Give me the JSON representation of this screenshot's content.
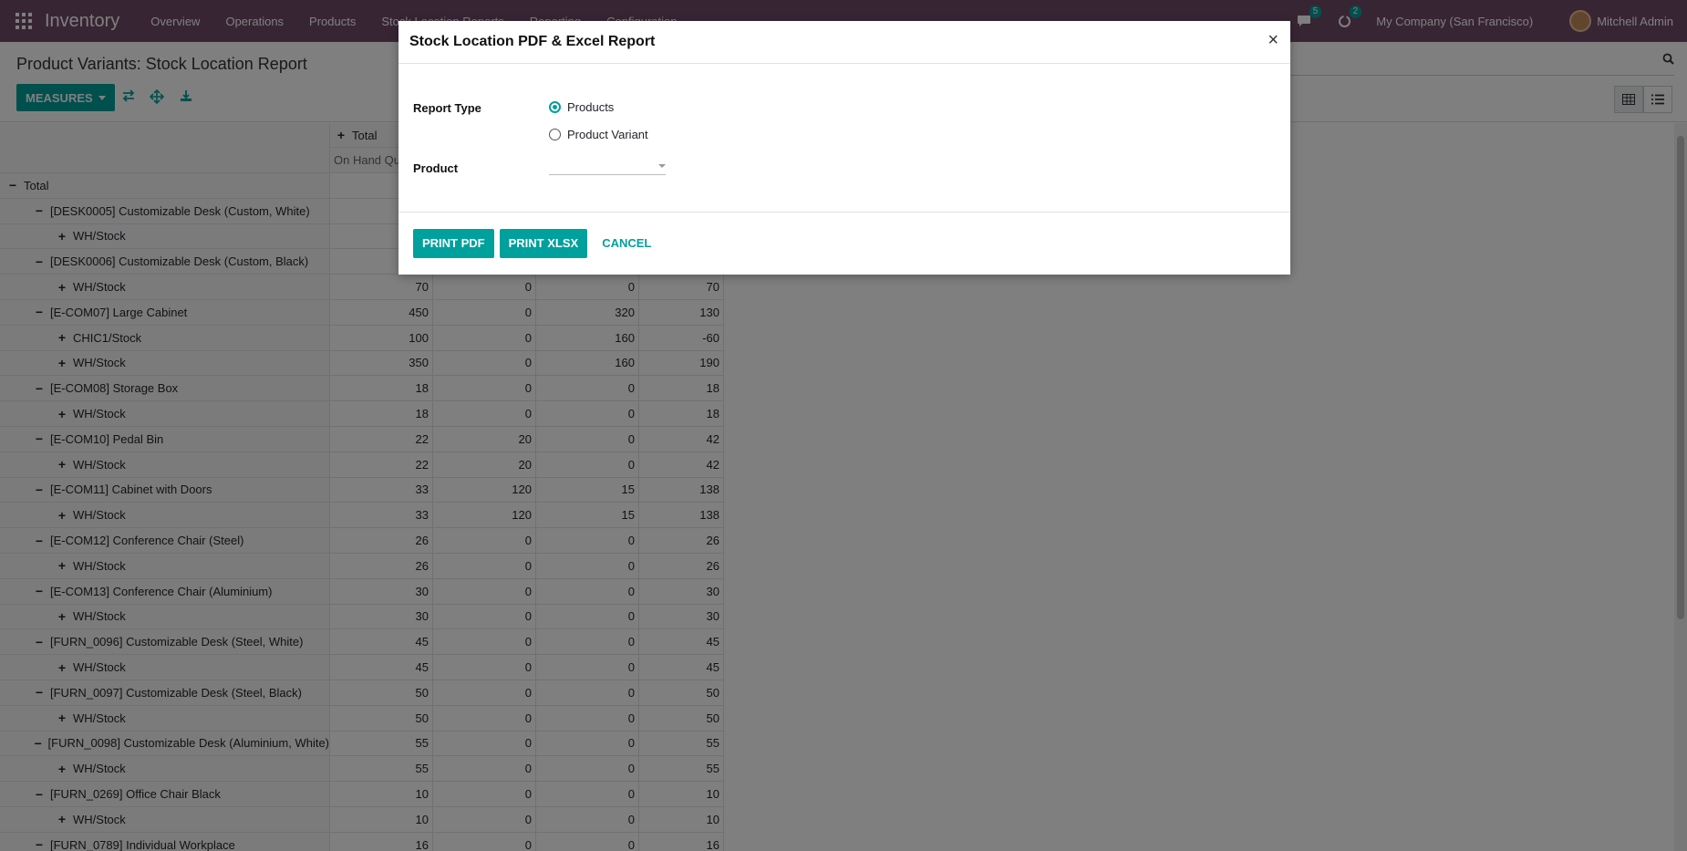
{
  "navbar": {
    "app_name": "Inventory",
    "menu": [
      "Overview",
      "Operations",
      "Products",
      "Stock Location Reports",
      "Reporting",
      "Configuration"
    ],
    "messages_count": "5",
    "activities_count": "2",
    "company": "My Company (San Francisco)",
    "user": "Mitchell Admin"
  },
  "control_panel": {
    "title": "Product Variants: Stock Location Report",
    "measures_label": "MEASURES"
  },
  "pivot": {
    "col_header": "Total",
    "col_subheader": "On Hand Qu",
    "total_label": "Total",
    "rows": [
      {
        "level": 1,
        "sign": "−",
        "label": "[DESK0005] Customizable Desk (Custom, White)",
        "values": [
          "",
          "",
          "",
          ""
        ]
      },
      {
        "level": 2,
        "sign": "+",
        "label": "WH/Stock",
        "values": [
          "",
          "",
          "",
          ""
        ]
      },
      {
        "level": 1,
        "sign": "−",
        "label": "[DESK0006] Customizable Desk (Custom, Black)",
        "values": [
          "",
          "",
          "",
          ""
        ]
      },
      {
        "level": 2,
        "sign": "+",
        "label": "WH/Stock",
        "values": [
          "70",
          "0",
          "0",
          "70"
        ]
      },
      {
        "level": 1,
        "sign": "−",
        "label": "[E-COM07] Large Cabinet",
        "values": [
          "450",
          "0",
          "320",
          "130"
        ]
      },
      {
        "level": 2,
        "sign": "+",
        "label": "CHIC1/Stock",
        "values": [
          "100",
          "0",
          "160",
          "-60"
        ]
      },
      {
        "level": 2,
        "sign": "+",
        "label": "WH/Stock",
        "values": [
          "350",
          "0",
          "160",
          "190"
        ]
      },
      {
        "level": 1,
        "sign": "−",
        "label": "[E-COM08] Storage Box",
        "values": [
          "18",
          "0",
          "0",
          "18"
        ]
      },
      {
        "level": 2,
        "sign": "+",
        "label": "WH/Stock",
        "values": [
          "18",
          "0",
          "0",
          "18"
        ]
      },
      {
        "level": 1,
        "sign": "−",
        "label": "[E-COM10] Pedal Bin",
        "values": [
          "22",
          "20",
          "0",
          "42"
        ]
      },
      {
        "level": 2,
        "sign": "+",
        "label": "WH/Stock",
        "values": [
          "22",
          "20",
          "0",
          "42"
        ]
      },
      {
        "level": 1,
        "sign": "−",
        "label": "[E-COM11] Cabinet with Doors",
        "values": [
          "33",
          "120",
          "15",
          "138"
        ]
      },
      {
        "level": 2,
        "sign": "+",
        "label": "WH/Stock",
        "values": [
          "33",
          "120",
          "15",
          "138"
        ]
      },
      {
        "level": 1,
        "sign": "−",
        "label": "[E-COM12] Conference Chair (Steel)",
        "values": [
          "26",
          "0",
          "0",
          "26"
        ]
      },
      {
        "level": 2,
        "sign": "+",
        "label": "WH/Stock",
        "values": [
          "26",
          "0",
          "0",
          "26"
        ]
      },
      {
        "level": 1,
        "sign": "−",
        "label": "[E-COM13] Conference Chair (Aluminium)",
        "values": [
          "30",
          "0",
          "0",
          "30"
        ]
      },
      {
        "level": 2,
        "sign": "+",
        "label": "WH/Stock",
        "values": [
          "30",
          "0",
          "0",
          "30"
        ]
      },
      {
        "level": 1,
        "sign": "−",
        "label": "[FURN_0096] Customizable Desk (Steel, White)",
        "values": [
          "45",
          "0",
          "0",
          "45"
        ]
      },
      {
        "level": 2,
        "sign": "+",
        "label": "WH/Stock",
        "values": [
          "45",
          "0",
          "0",
          "45"
        ]
      },
      {
        "level": 1,
        "sign": "−",
        "label": "[FURN_0097] Customizable Desk (Steel, Black)",
        "values": [
          "50",
          "0",
          "0",
          "50"
        ]
      },
      {
        "level": 2,
        "sign": "+",
        "label": "WH/Stock",
        "values": [
          "50",
          "0",
          "0",
          "50"
        ]
      },
      {
        "level": 1,
        "sign": "−",
        "label": "[FURN_0098] Customizable Desk (Aluminium, White)",
        "values": [
          "55",
          "0",
          "0",
          "55"
        ]
      },
      {
        "level": 2,
        "sign": "+",
        "label": "WH/Stock",
        "values": [
          "55",
          "0",
          "0",
          "55"
        ]
      },
      {
        "level": 1,
        "sign": "−",
        "label": "[FURN_0269] Office Chair Black",
        "values": [
          "10",
          "0",
          "0",
          "10"
        ]
      },
      {
        "level": 2,
        "sign": "+",
        "label": "WH/Stock",
        "values": [
          "10",
          "0",
          "0",
          "10"
        ]
      },
      {
        "level": 1,
        "sign": "−",
        "label": "[FURN_0789] Individual Workplace",
        "values": [
          "16",
          "0",
          "0",
          "16"
        ]
      }
    ]
  },
  "modal": {
    "title": "Stock Location PDF & Excel Report",
    "close_label": "×",
    "report_type_label": "Report Type",
    "option_products": "Products",
    "option_product_variant": "Product Variant",
    "selected_option": "Products",
    "product_label": "Product",
    "product_value": "",
    "print_pdf": "PRINT PDF",
    "print_xlsx": "PRINT XLSX",
    "cancel": "CANCEL"
  },
  "colors": {
    "navbar": "#714B67",
    "accent": "#00A09D"
  }
}
